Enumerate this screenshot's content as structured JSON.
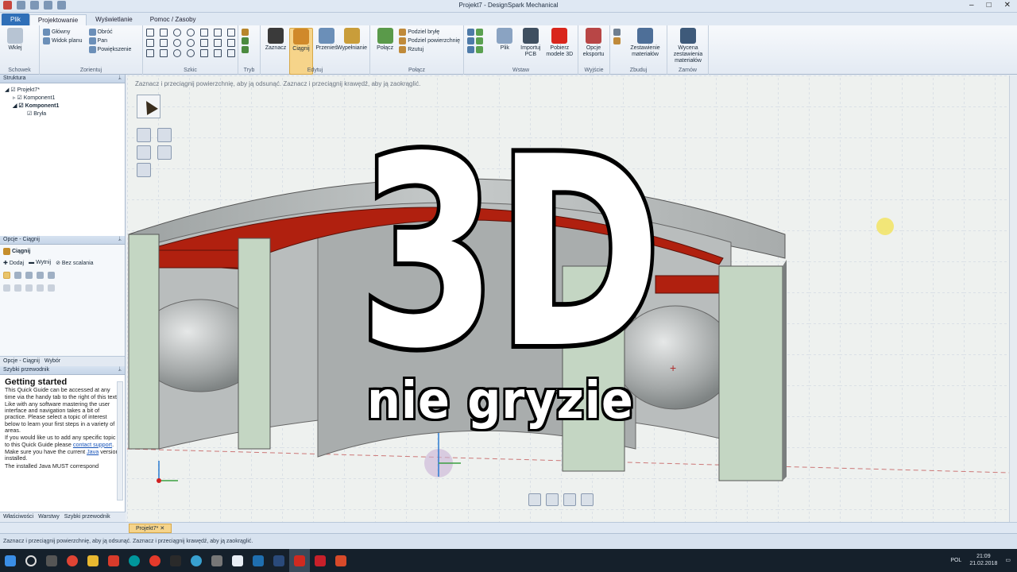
{
  "window": {
    "title": "Projekt7 - DesignSpark Mechanical"
  },
  "tabs": [
    "Plik",
    "Projektowanie",
    "Wyświetlanie",
    "Pomoc / Zasoby"
  ],
  "ribbon": {
    "schowek": {
      "label": "Schowek",
      "items": [
        "Wklej"
      ]
    },
    "orient": {
      "label": "Zorientuj",
      "items": [
        "Główny",
        "Widok planu",
        "Obróć",
        "Pan",
        "Powiększenie"
      ]
    },
    "szkic": {
      "label": "Szkic"
    },
    "tryb": {
      "label": "Tryb"
    },
    "edytuj": {
      "label": "Edytuj",
      "items": [
        "Zaznacz",
        "Ciągnij",
        "Przenieś",
        "Wypełnianie"
      ]
    },
    "polacz": {
      "label": "Połącz",
      "items": [
        "Połącz",
        "Podziel bryłę",
        "Podziel powierzchnię",
        "Rzutuj"
      ]
    },
    "wstaw": {
      "label": "Wstaw",
      "items": [
        "Plik",
        "Importuj PCB",
        "Pobierz modele 3D"
      ]
    },
    "wyjscie": {
      "label": "Wyjście",
      "items": [
        "Opcje eksportu"
      ]
    },
    "zbuduj": {
      "label": "Zbuduj",
      "items": [
        "Zestawienie materiałów"
      ]
    },
    "zamow": {
      "label": "Zamów",
      "items": [
        "Wycena zestawienia materiałów"
      ]
    }
  },
  "structure": {
    "header": "Struktura",
    "tree": [
      "Projekt7*",
      "Komponent1",
      "Komponent1",
      "Bryła"
    ]
  },
  "options": {
    "header": "Opcje - Ciągnij",
    "section": "Ciągnij",
    "buttons": [
      "Dodaj",
      "Wytnij",
      "Bez scalania"
    ],
    "tabs": [
      "Opcje - Ciągnij",
      "Wybór"
    ]
  },
  "guide": {
    "header": "Szybki przewodnik",
    "title": "Getting started",
    "p1": "This Quick Guide can be accessed at any time via the handy tab to the right of this text.",
    "p2": "Like with any software mastering the user interface and navigation takes a bit of practice. Please select a topic of interest below to learn your first steps in a variety of areas.",
    "p3a": "If you would like us to add any specific topic to this Quick Guide please",
    "p3link": "contact support",
    "p4a": "Make sure you have the current",
    "p4link": "Java",
    "p4b": "version installed.",
    "p5": "The installed Java MUST correspond",
    "tabs": [
      "Właściwości",
      "Warstwy",
      "Szybki przewodnik"
    ]
  },
  "viewport": {
    "hint": "Zaznacz i przeciągnij powierzchnię, aby ją odsunąć. Zaznacz i przeciągnij krawędź, aby ją zaokrąglić.",
    "doc_tab": "Projekt7*"
  },
  "status": {
    "text": "Zaznacz i przeciągnij powierzchnię, aby ją odsunąć. Zaznacz i przeciągnij krawędź, aby ją zaokrąglić."
  },
  "overlay": {
    "big": "3D",
    "subtitle": "nie gryzie"
  },
  "tray": {
    "lang": "POL",
    "time": "21:09",
    "date": "21.02.2018"
  },
  "colors": {
    "accent": "#2f6fb8",
    "red_part": "#b0200f",
    "green_part": "#c4d6c3",
    "gray_part": "#b8bcbc"
  }
}
